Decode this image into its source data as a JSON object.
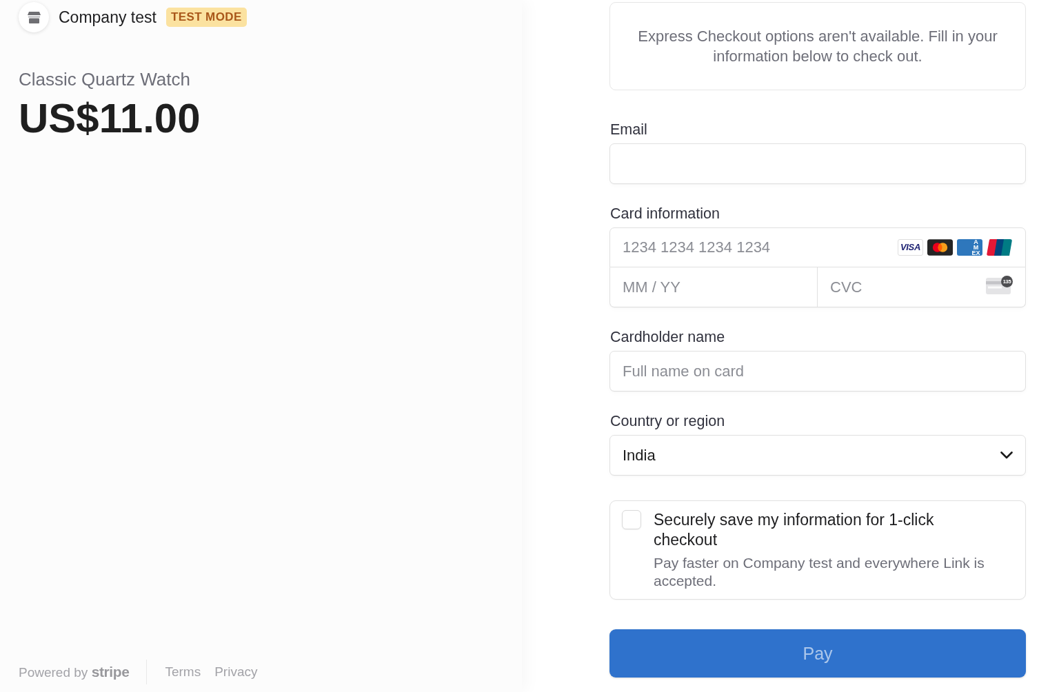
{
  "merchant": {
    "name": "Company test",
    "badge": "TEST MODE"
  },
  "product": {
    "name": "Classic Quartz Watch",
    "price": "US$11.00"
  },
  "footer": {
    "powered_by": "Powered by **stripe**",
    "links": [
      "Terms",
      "Privacy"
    ]
  },
  "express_checkout": {
    "message": "Express Checkout options aren't available. Fill in your information below to check out."
  },
  "email": {
    "label": "Email"
  },
  "card_information": {
    "label": "Card information",
    "number": {
      "placeholder": "1234 1234 1234 1234"
    },
    "brands": [
      {
        "kind": "visa",
        "label": "VISA"
      },
      {
        "kind": "mastercard"
      },
      {
        "kind": "amex",
        "label": "AMEX"
      },
      {
        "kind": "unionpay"
      }
    ],
    "expiry": {
      "placeholder": "MM / YY"
    },
    "cvc": {
      "placeholder": "CVC",
      "hint": "135"
    }
  },
  "cardholder_name": {
    "label": "Cardholder name",
    "placeholder": "Full name on card"
  },
  "country": {
    "label": "Country or region",
    "value": "India"
  },
  "save_info": {
    "checked": false,
    "title": "Securely save my information for 1-click checkout",
    "description": "Pay faster on Company test and everywhere Link is accepted."
  },
  "pay_button": {
    "label": "Pay",
    "disabled": true
  }
}
